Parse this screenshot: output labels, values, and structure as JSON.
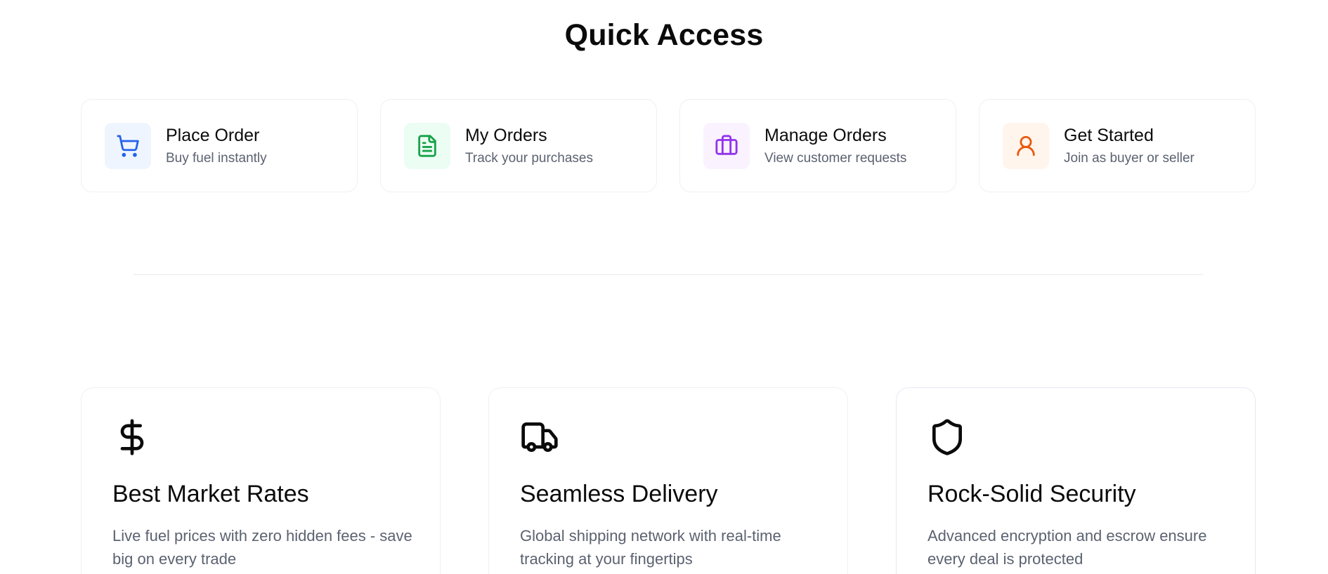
{
  "quick_access": {
    "title": "Quick Access",
    "items": [
      {
        "title": "Place Order",
        "subtitle": "Buy fuel instantly",
        "icon": "shopping-cart-icon",
        "color": "#2563eb"
      },
      {
        "title": "My Orders",
        "subtitle": "Track your purchases",
        "icon": "file-text-icon",
        "color": "#16a34a"
      },
      {
        "title": "Manage Orders",
        "subtitle": "View customer requests",
        "icon": "briefcase-icon",
        "color": "#9333ea"
      },
      {
        "title": "Get Started",
        "subtitle": "Join as buyer or seller",
        "icon": "user-icon",
        "color": "#ea580c"
      }
    ]
  },
  "features": {
    "items": [
      {
        "title": "Best Market Rates",
        "description": "Live fuel prices with zero hidden fees - save big on every trade",
        "icon": "dollar-sign-icon"
      },
      {
        "title": "Seamless Delivery",
        "description": "Global shipping network with real-time tracking at your fingertips",
        "icon": "truck-icon"
      },
      {
        "title": "Rock-Solid Security",
        "description": "Advanced encryption and escrow ensure every deal is protected",
        "icon": "shield-icon"
      }
    ]
  }
}
